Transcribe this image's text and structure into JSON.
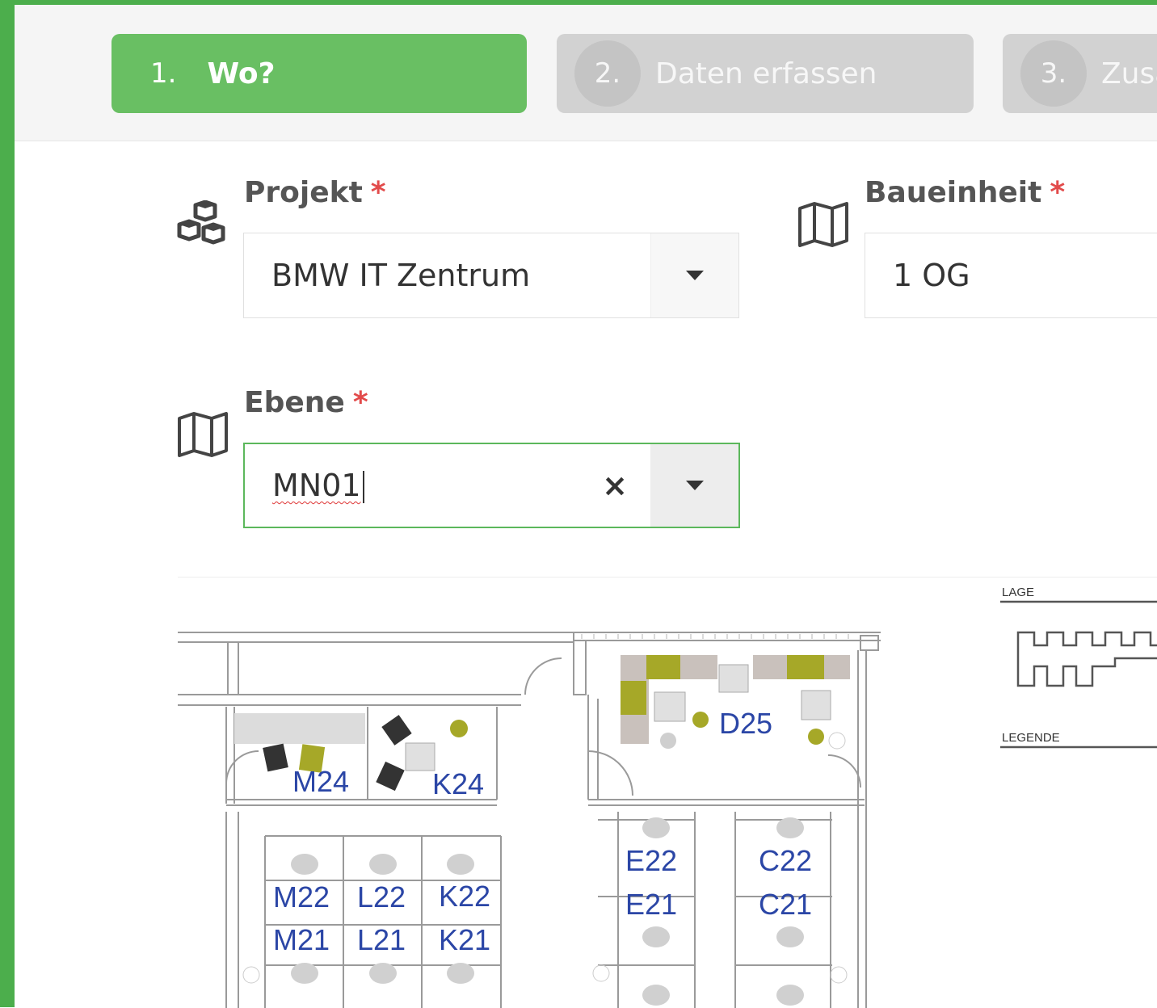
{
  "steps": [
    {
      "number": "1.",
      "label": "Wo?"
    },
    {
      "number": "2.",
      "label": "Daten erfassen"
    },
    {
      "number": "3.",
      "label": "Zusa"
    }
  ],
  "form": {
    "projekt": {
      "label": "Projekt",
      "required": "*",
      "value": "BMW IT Zentrum",
      "icon": "cubes-icon"
    },
    "baueinheit": {
      "label": "Baueinheit",
      "required": "*",
      "value": "1 OG",
      "icon": "map-icon"
    },
    "ebene": {
      "label": "Ebene",
      "required": "*",
      "value": "MN01",
      "clear": "×",
      "icon": "map-icon"
    }
  },
  "floorplan": {
    "lage_label": "LAGE",
    "legende_label": "LEGENDE",
    "rooms": [
      "M24",
      "K24",
      "D25",
      "M22",
      "L22",
      "K22",
      "M21",
      "L21",
      "K21",
      "E22",
      "E21",
      "C22",
      "C21"
    ]
  },
  "colors": {
    "accent": "#5cb85c",
    "required": "#e24a4a",
    "room_label": "#2b46a6",
    "furniture_olive": "#a6a828"
  }
}
